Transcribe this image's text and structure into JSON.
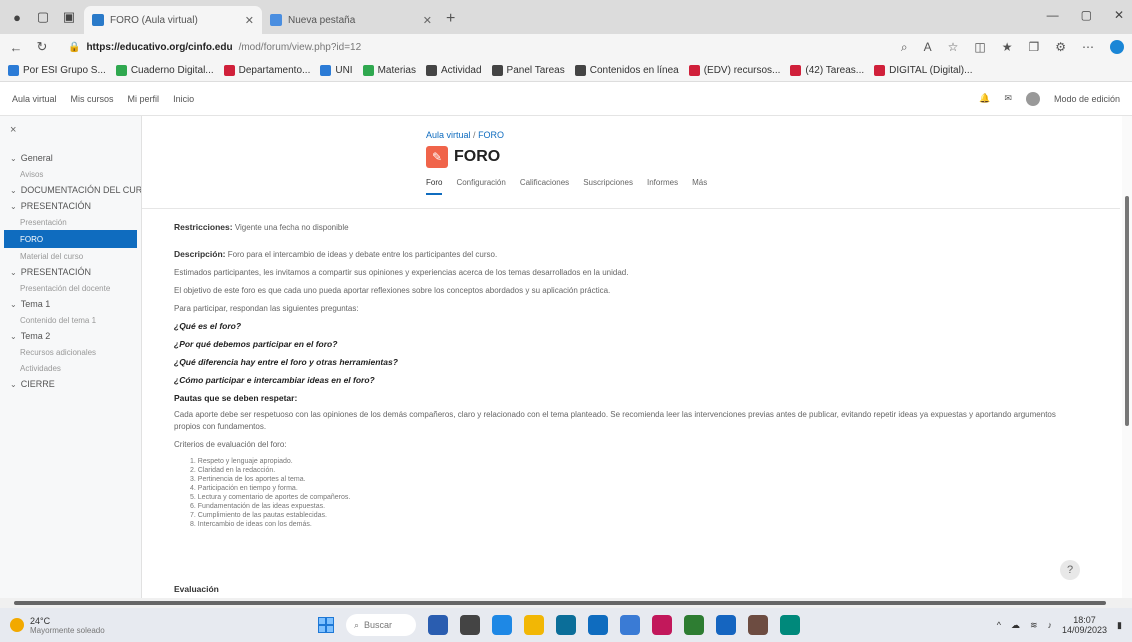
{
  "browser": {
    "tabs": [
      {
        "label": "FORO (Aula virtual)",
        "active": true
      },
      {
        "label": "Nueva pestaña",
        "active": false
      }
    ],
    "url_host": "https://educativo.org/cinfo.edu",
    "url_path": "/mod/forum/view.php?id=12",
    "favorites": [
      {
        "label": "Por ESI Grupo S...",
        "color": "#2b7bd6"
      },
      {
        "label": "Cuaderno Digital...",
        "color": "#2fa84f"
      },
      {
        "label": "Departamento...",
        "color": "#d0203a"
      },
      {
        "label": "UNI",
        "color": "#2b7bd6"
      },
      {
        "label": "Materias",
        "color": "#2fa84f"
      },
      {
        "label": "Actividad",
        "color": "#444444"
      },
      {
        "label": "Panel Tareas",
        "color": "#444444"
      },
      {
        "label": "Contenidos en línea",
        "color": "#444444"
      },
      {
        "label": "(EDV) recursos...",
        "color": "#d0203a"
      },
      {
        "label": "(42) Tareas...",
        "color": "#d0203a"
      },
      {
        "label": "DIGITAL (Digital)...",
        "color": "#d0203a"
      }
    ]
  },
  "topnav": {
    "items": [
      "Aula virtual",
      "Mis cursos",
      "Mi perfil",
      "Inicio"
    ],
    "right": "Modo de edición"
  },
  "sidebar": {
    "close": "×",
    "items": [
      {
        "label": "General",
        "level": 0,
        "active": false
      },
      {
        "label": "Avisos",
        "level": 1,
        "active": false
      },
      {
        "label": "DOCUMENTACIÓN DEL CURSO",
        "level": 0,
        "active": false
      },
      {
        "label": "PRESENTACIÓN",
        "level": 0,
        "active": false
      },
      {
        "label": "Presentación",
        "level": 1,
        "active": false
      },
      {
        "label": "FORO",
        "level": 1,
        "active": true
      },
      {
        "label": "Material del curso",
        "level": 1,
        "active": false
      },
      {
        "label": "PRESENTACIÓN",
        "level": 0,
        "active": false
      },
      {
        "label": "Presentación del docente",
        "level": 1,
        "active": false
      },
      {
        "label": "Tema 1",
        "level": 0,
        "active": false
      },
      {
        "label": "Contenido del tema 1",
        "level": 1,
        "active": false
      },
      {
        "label": "Tema 2",
        "level": 0,
        "active": false
      },
      {
        "label": "Recursos adicionales",
        "level": 1,
        "active": false
      },
      {
        "label": "Actividades",
        "level": 1,
        "active": false
      },
      {
        "label": "CIERRE",
        "level": 0,
        "active": false
      }
    ]
  },
  "main": {
    "breadcrumb": [
      "Aula virtual",
      "FORO"
    ],
    "title": "FORO",
    "tabs": [
      "Foro",
      "Configuración",
      "Calificaciones",
      "Suscripciones",
      "Informes",
      "Más"
    ],
    "restrictions_label": "Restricciones:",
    "restrictions_text": "Vigente una fecha no disponible",
    "intro_label": "Descripción:",
    "intro_text": "Foro para el intercambio de ideas y debate entre los participantes del curso.",
    "para2": "Estimados participantes, les invitamos a compartir sus opiniones y experiencias acerca de los temas desarrollados en la unidad.",
    "para3": "El objetivo de este foro es que cada uno pueda aportar reflexiones sobre los conceptos abordados y su aplicación práctica.",
    "para4": "Para participar, respondan las siguientes preguntas:",
    "questions": [
      "¿Qué es el foro?",
      "¿Por qué debemos participar en el foro?",
      "¿Qué diferencia hay entre el foro y otras herramientas?",
      "¿Cómo participar e intercambiar ideas en el foro?"
    ],
    "heading": "Pautas que se deben respetar:",
    "para5": "Cada aporte debe ser respetuoso con las opiniones de los demás compañeros, claro y relacionado con el tema planteado. Se recomienda leer las intervenciones previas antes de publicar, evitando repetir ideas ya expuestas y aportando argumentos propios con fundamentos.",
    "para6": "Criterios de evaluación del foro:",
    "list": [
      "1. Respeto y lenguaje apropiado.",
      "2. Claridad en la redacción.",
      "3. Pertinencia de los aportes al tema.",
      "4. Participación en tiempo y forma.",
      "5. Lectura y comentario de aportes de compañeros.",
      "6. Fundamentación de las ideas expuestas.",
      "7. Cumplimiento de las pautas establecidas.",
      "8. Intercambio de ideas con los demás."
    ],
    "evaluation_label": "Evaluación"
  },
  "taskbar": {
    "weather_temp": "24°C",
    "weather_desc": "Mayormente soleado",
    "search_placeholder": "Buscar",
    "apps": [
      "#2a5db0",
      "#444444",
      "#1e88e5",
      "#f2b705",
      "#0b6e99",
      "#0f6cbf",
      "#3a7bd5",
      "#c2185b",
      "#2e7d32",
      "#1565c0",
      "#6d4c41",
      "#00897b"
    ],
    "time": "18:07",
    "date": "14/09/2023"
  }
}
